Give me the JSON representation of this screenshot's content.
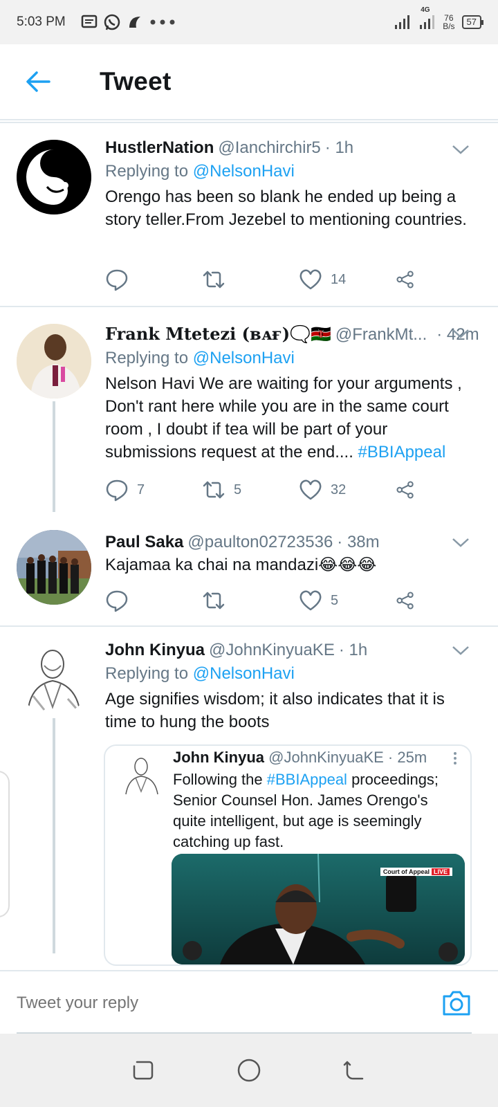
{
  "status_bar": {
    "time": "5:03 PM",
    "icons": [
      "message-icon",
      "whatsapp-icon",
      "app-icon",
      "more-dots-icon"
    ],
    "net_label": "4G",
    "speed_value": "76",
    "speed_unit": "B/s",
    "battery": "57"
  },
  "header": {
    "title": "Tweet",
    "accent": "#1da1f2"
  },
  "tweets": [
    {
      "name": "HustlerNation",
      "handle": "@Ianchirchir5",
      "time": "· 1h",
      "reply_prefix": "Replying to",
      "reply_to": "@NelsonHavi",
      "text": "Orengo has been so blank he ended up being a story teller.From Jezebel to mentioning countries.",
      "replies": "",
      "retweets": "",
      "likes": "14"
    },
    {
      "name": "Frank Mtetezi (ʙᴀғ)🗨️🇰🇪",
      "handle": "@FrankMt...",
      "time": "· 42m",
      "reply_prefix": "Replying to",
      "reply_to": "@NelsonHavi",
      "text": "Nelson Havi We are waiting for your arguments , Don't rant here while you are in the same court room , I doubt if tea will be part of your submissions request at the end.... ",
      "hashtag": "#BBIAppeal",
      "replies": "7",
      "retweets": "5",
      "likes": "32"
    },
    {
      "name": "Paul Saka",
      "handle": "@paulton02723536",
      "time": "· 38m",
      "text": "Kajamaa ka chai na mandazi😂😂😂",
      "replies": "",
      "retweets": "",
      "likes": "5"
    },
    {
      "name": "John Kinyua",
      "handle": "@JohnKinyuaKE",
      "time": "· 1h",
      "reply_prefix": "Replying to",
      "reply_to": "@NelsonHavi",
      "text": "Age signifies wisdom; it also indicates that it is time to hung the boots",
      "quote": {
        "name": "John Kinyua",
        "handle": "@JohnKinyuaKE",
        "time": "· 25m",
        "text_before": "Following the ",
        "hashtag": "#BBIAppeal",
        "text_after": " proceedings; Senior Counsel Hon. James Orengo's quite intelligent, but age is seemingly catching up fast.",
        "banner_text": "Court of Appeal",
        "banner_live": "LIVE"
      }
    }
  ],
  "reply_bar": {
    "placeholder": "Tweet your reply"
  }
}
